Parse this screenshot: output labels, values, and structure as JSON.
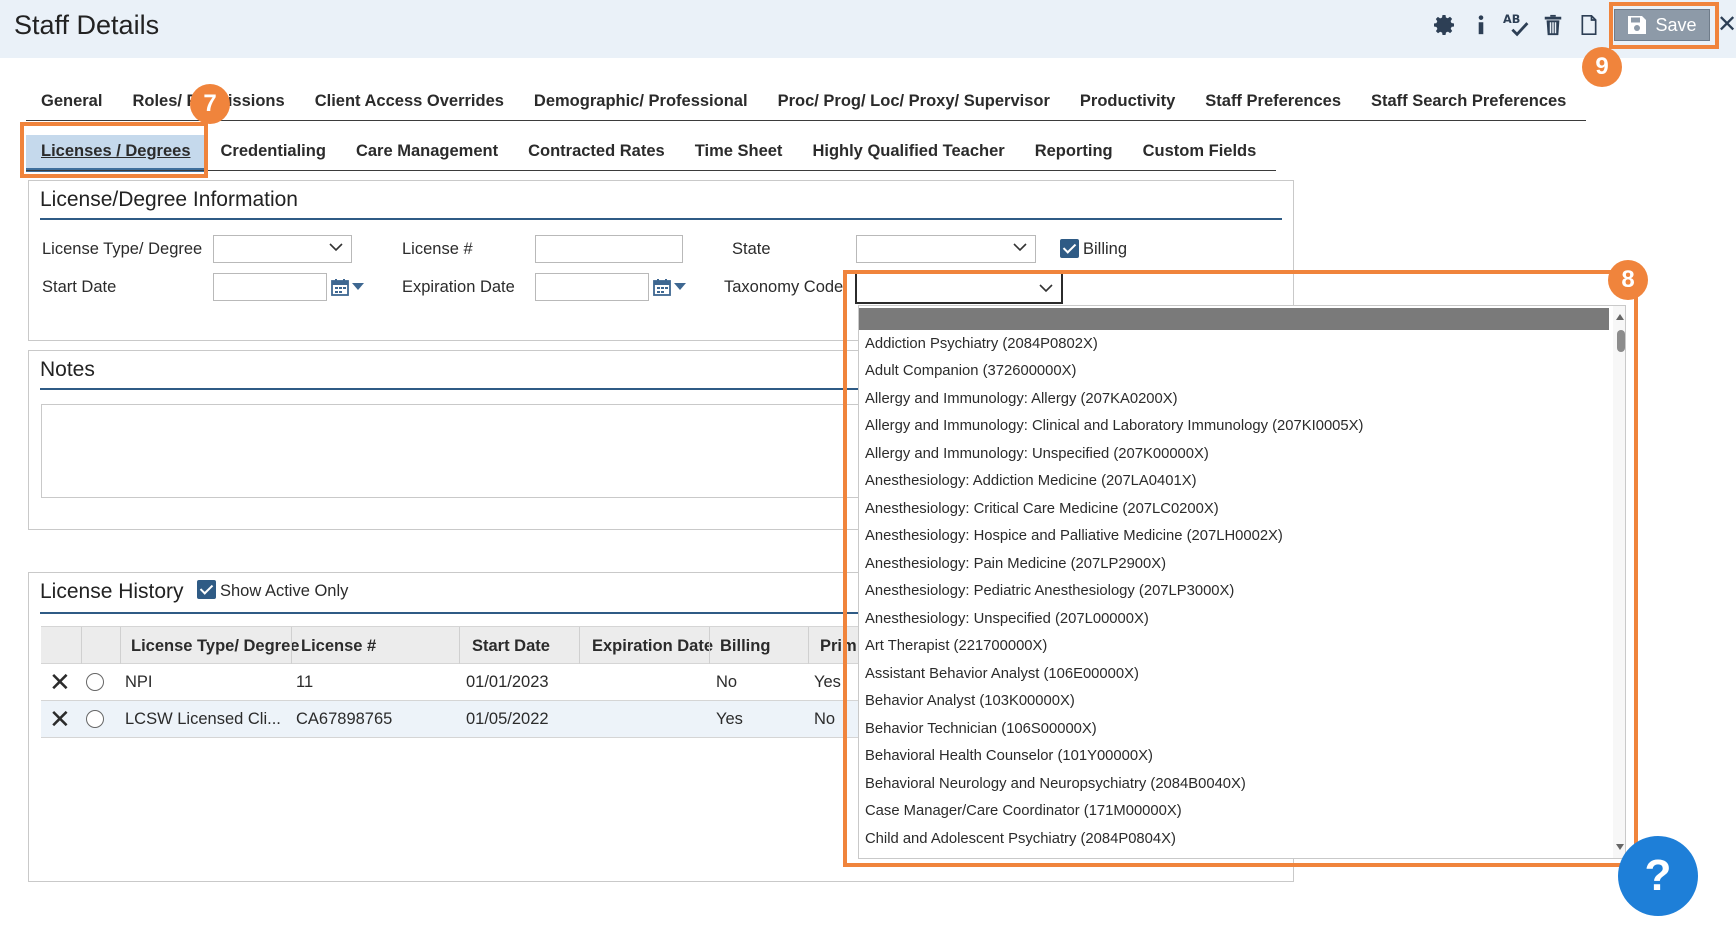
{
  "header": {
    "title": "Staff Details",
    "save_label": "Save"
  },
  "annotations": {
    "tabs_step": "7",
    "taxonomy_step": "8",
    "save_step": "9"
  },
  "tabs_row1": [
    "General",
    "Roles/ Permissions",
    "Client Access Overrides",
    "Demographic/ Professional",
    "Proc/ Prog/ Loc/ Proxy/ Supervisor",
    "Productivity",
    "Staff Preferences",
    "Staff Search Preferences"
  ],
  "tabs_row2": [
    "Licenses / Degrees",
    "Credentialing",
    "Care Management",
    "Contracted Rates",
    "Time Sheet",
    "Highly Qualified Teacher",
    "Reporting",
    "Custom Fields"
  ],
  "license_info": {
    "title": "License/Degree Information",
    "license_type_label": "License Type/ Degree",
    "license_num_label": "License #",
    "state_label": "State",
    "billing_label": "Billing",
    "billing_checked": true,
    "start_date_label": "Start Date",
    "expiration_label": "Expiration Date",
    "taxonomy_label": "Taxonomy Code"
  },
  "notes": {
    "title": "Notes"
  },
  "history": {
    "title": "License History",
    "show_active_label": "Show Active Only",
    "columns": [
      "License Type/ Degree",
      "License #",
      "Start Date",
      "Expiration Date",
      "Billing",
      "Prim"
    ],
    "rows": [
      {
        "type": "NPI",
        "license": "11",
        "start": "01/01/2023",
        "expiration": "",
        "billing": "No",
        "primary": "Yes"
      },
      {
        "type": "LCSW Licensed Cli...",
        "license": "CA67898765",
        "start": "01/05/2022",
        "expiration": "",
        "billing": "Yes",
        "primary": "No"
      }
    ]
  },
  "taxonomy_options": [
    "Addiction Psychiatry (2084P0802X)",
    "Adult Companion (372600000X)",
    "Allergy and Immunology: Allergy (207KA0200X)",
    "Allergy and Immunology: Clinical and Laboratory Immunology (207KI0005X)",
    "Allergy and Immunology: Unspecified (207K00000X)",
    "Anesthesiology: Addiction Medicine (207LA0401X)",
    "Anesthesiology: Critical Care Medicine (207LC0200X)",
    "Anesthesiology: Hospice and Palliative Medicine (207LH0002X)",
    "Anesthesiology: Pain Medicine (207LP2900X)",
    "Anesthesiology: Pediatric Anesthesiology (207LP3000X)",
    "Anesthesiology: Unspecified (207L00000X)",
    "Art Therapist (221700000X)",
    "Assistant Behavior Analyst (106E00000X)",
    "Behavior Analyst (103K00000X)",
    "Behavior Technician (106S00000X)",
    "Behavioral Health Counselor (101Y00000X)",
    "Behavioral Neurology and Neuropsychiatry (2084B0040X)",
    "Case Manager/Care Coordinator (171M00000X)",
    "Child and Adolescent Psychiatry (2084P0804X)"
  ],
  "help_label": "?",
  "accent_color": "#f0843c"
}
